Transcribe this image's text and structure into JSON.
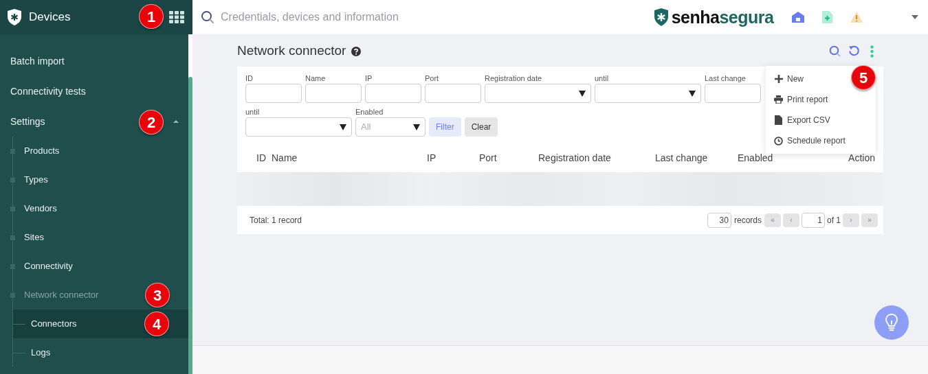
{
  "app": {
    "title": "Devices"
  },
  "search": {
    "placeholder": "Credentials, devices and information"
  },
  "brand": {
    "first": "senha",
    "second": "segura"
  },
  "sidebar": {
    "items": [
      {
        "label": "Batch import"
      },
      {
        "label": "Connectivity tests"
      },
      {
        "label": "Settings",
        "expanded": true,
        "children": [
          {
            "label": "Products",
            "dimmed": false
          },
          {
            "label": "Types",
            "dimmed": false
          },
          {
            "label": "Vendors",
            "dimmed": false
          },
          {
            "label": "Sites",
            "dimmed": false
          },
          {
            "label": "Connectivity",
            "dimmed": false
          },
          {
            "label": "Network connector",
            "dimmed": true,
            "children": [
              {
                "label": "Connectors",
                "selected": true
              },
              {
                "label": "Logs",
                "selected": false
              }
            ]
          }
        ]
      }
    ]
  },
  "page": {
    "title": "Network connector"
  },
  "filter_rows": [
    [
      {
        "label": "ID",
        "kind": "text"
      },
      {
        "label": "Name",
        "kind": "text"
      },
      {
        "label": "IP",
        "kind": "text"
      },
      {
        "label": "Port",
        "kind": "text"
      },
      {
        "label": "Registration date",
        "kind": "select"
      },
      {
        "label": "until",
        "kind": "select"
      },
      {
        "label": "Last change",
        "kind": "text"
      }
    ],
    [
      {
        "label": "until",
        "kind": "select"
      },
      {
        "label": "Enabled",
        "kind": "select",
        "value": "All"
      }
    ]
  ],
  "filter_buttons": [
    {
      "label": "Filter",
      "kind": "primary"
    },
    {
      "label": "Clear",
      "kind": "secondary"
    }
  ],
  "table": {
    "columns": [
      "ID",
      "Name",
      "IP",
      "Port",
      "Registration date",
      "Last change",
      "Enabled",
      "Action"
    ]
  },
  "footer": {
    "total": "Total: 1 record",
    "page_size": "30",
    "records_label": "records",
    "page": "1",
    "page_of": "of 1",
    "nav": [
      "«",
      "‹",
      "›",
      "»"
    ]
  },
  "menu": {
    "items": [
      {
        "label": "New",
        "kind": "new"
      },
      {
        "label": "Print report",
        "kind": "print"
      },
      {
        "label": "Export CSV",
        "kind": "file"
      },
      {
        "label": "Schedule report",
        "kind": "clock"
      }
    ]
  },
  "badges": [
    "1",
    "2",
    "3",
    "4",
    "5"
  ]
}
